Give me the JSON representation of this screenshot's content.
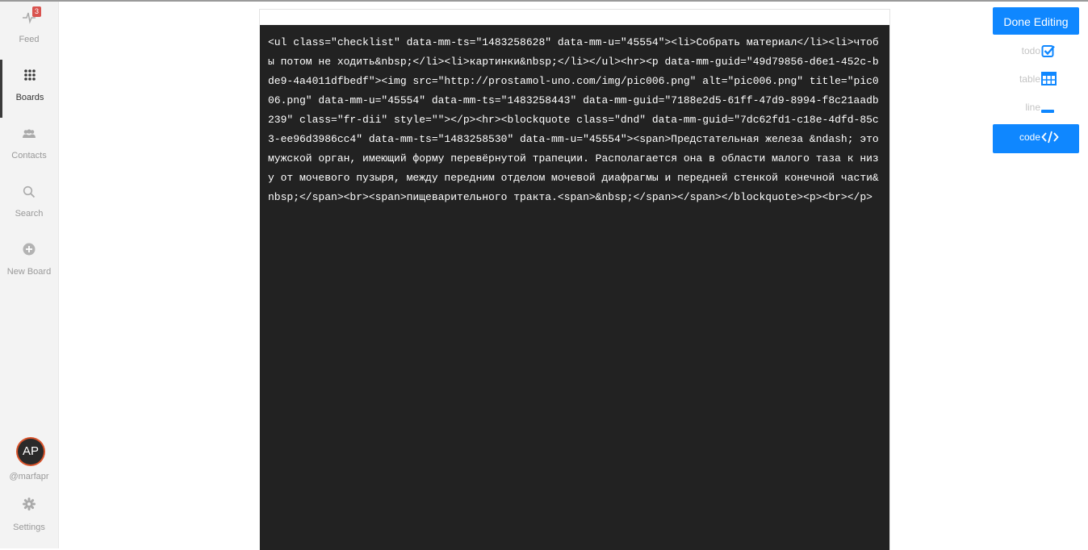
{
  "sidebar": {
    "items": [
      {
        "label": "Feed",
        "badge": "3",
        "icon": "pulse-icon"
      },
      {
        "label": "Boards",
        "icon": "grid-dots-icon"
      },
      {
        "label": "Contacts",
        "icon": "people-icon"
      },
      {
        "label": "Search",
        "icon": "search-icon"
      },
      {
        "label": "New Board",
        "icon": "plus-circle-icon"
      }
    ],
    "active": "Boards",
    "user": {
      "avatar_text": "AP",
      "username": "@marfapr"
    },
    "settings_label": "Settings"
  },
  "editor": {
    "code": "<ul class=\"checklist\" data-mm-ts=\"1483258628\" data-mm-u=\"45554\"><li>Собрать материал</li><li>чтобы потом не ходить&nbsp;</li><li>картинки&nbsp;</li></ul><hr><p data-mm-guid=\"49d79856-d6e1-452c-bde9-4a4011dfbedf\"><img src=\"http://prostamol-uno.com/img/pic006.png\" alt=\"pic006.png\" title=\"pic006.png\" data-mm-u=\"45554\" data-mm-ts=\"1483258443\" data-mm-guid=\"7188e2d5-61ff-47d9-8994-f8c21aadb239\" class=\"fr-dii\" style=\"\"></p><hr><blockquote class=\"dnd\" data-mm-guid=\"7dc62fd1-c18e-4dfd-85c3-ee96d3986cc4\" data-mm-ts=\"1483258530\" data-mm-u=\"45554\"><span>Предстательная железа &ndash; это мужской орган, имеющий форму перевёрнутой трапеции. Располагается она в области малого таза к низу от мочевого пузыря, между передним отделом мочевой диафрагмы и передней стенкой конечной части&nbsp;</span><br><span>пищеварительного тракта.<span>&nbsp;</span></span></blockquote><p><br></p>"
  },
  "toolbar": {
    "done_label": "Done Editing",
    "tools": [
      {
        "label": "todo",
        "icon": "checkbox-icon"
      },
      {
        "label": "table",
        "icon": "table-icon"
      },
      {
        "label": "line",
        "icon": "line-icon"
      },
      {
        "label": "code",
        "icon": "code-icon",
        "active": true
      }
    ],
    "accent": "#0f87ff"
  }
}
